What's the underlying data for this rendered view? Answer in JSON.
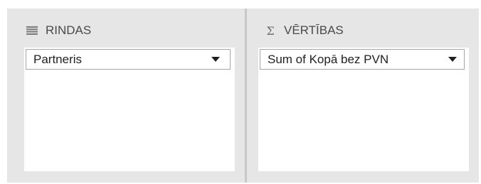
{
  "rows_area": {
    "icon": "rows-list-icon",
    "title": "RINDAS",
    "fields": [
      {
        "label": "Partneris",
        "icon": "dropdown-arrow-icon"
      }
    ]
  },
  "values_area": {
    "icon": "sigma-icon",
    "icon_glyph": "Σ",
    "title": "VĒRTĪBAS",
    "fields": [
      {
        "label": "Sum of Kopā bez PVN",
        "icon": "dropdown-arrow-icon"
      }
    ]
  },
  "colors": {
    "panel_background": "#e6e6e6",
    "list_background": "#ffffff",
    "pill_border": "#a6a6a6",
    "header_text": "#4a4a4a"
  }
}
